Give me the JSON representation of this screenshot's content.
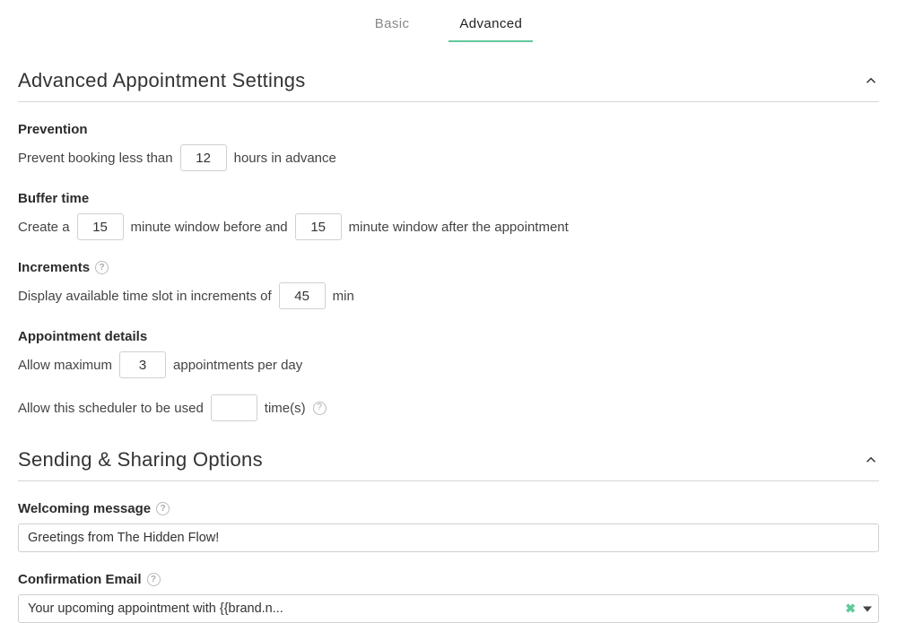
{
  "tabs": {
    "basic": "Basic",
    "advanced": "Advanced"
  },
  "sections": {
    "advanced_appointment": {
      "title": "Advanced Appointment Settings"
    },
    "sending_sharing": {
      "title": "Sending & Sharing Options"
    }
  },
  "prevention": {
    "label": "Prevention",
    "before": "Prevent booking less than",
    "value": "12",
    "after": "hours in advance"
  },
  "buffer": {
    "label": "Buffer time",
    "part1": "Create a",
    "before_value": "15",
    "part2": "minute window before and",
    "after_value": "15",
    "part3": "minute window after the appointment"
  },
  "increments": {
    "label": "Increments",
    "before": "Display available time slot in increments of",
    "value": "45",
    "unit": "min"
  },
  "details": {
    "label": "Appointment details",
    "max_before": "Allow maximum",
    "max_value": "3",
    "max_after": "appointments per day",
    "times_before": "Allow this scheduler to be used",
    "times_value": "",
    "times_after": "time(s)"
  },
  "welcoming": {
    "label": "Welcoming message",
    "value": "Greetings from The Hidden Flow!"
  },
  "confirmation": {
    "label": "Confirmation Email",
    "value": "Your upcoming appointment with {{brand.n..."
  },
  "help_glyph": "?"
}
